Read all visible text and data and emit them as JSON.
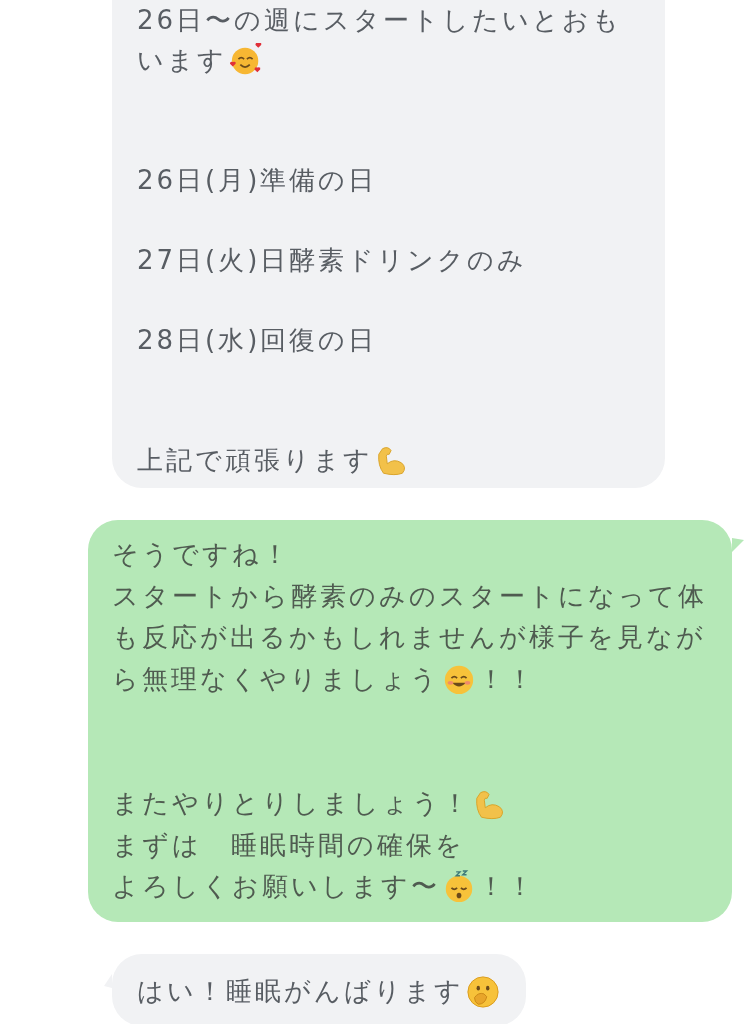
{
  "messages": [
    {
      "kind": "received",
      "lines": [
        {
          "kind": "text",
          "text": "26日〜の週にスタートしたいとおも"
        },
        {
          "kind": "emoji",
          "text": "います"
        },
        {
          "kind": "blank"
        },
        {
          "kind": "blank"
        },
        {
          "kind": "text",
          "text": "26日(月)準備の日"
        },
        {
          "kind": "blank"
        },
        {
          "kind": "text",
          "text": "27日(火)日酵素ドリンクのみ"
        },
        {
          "kind": "blank"
        },
        {
          "kind": "text",
          "text": "28日(水)回復の日"
        },
        {
          "kind": "blank"
        },
        {
          "kind": "blank"
        },
        {
          "kind": "emoji",
          "text": "上記で頑張ります"
        }
      ]
    },
    {
      "kind": "sent",
      "lines": [
        {
          "kind": "text",
          "text": "そうですね！"
        },
        {
          "kind": "text",
          "text": "スタートから酵素のみのスタートになって体"
        },
        {
          "kind": "text",
          "text": "も反応が出るかもしれませんが様子を見なが"
        },
        {
          "kind": "emoji",
          "text": "ら無理なくやりましょう",
          "after": "！！"
        },
        {
          "kind": "blank"
        },
        {
          "kind": "blank"
        },
        {
          "kind": "emoji",
          "text": "またやりとりしましょう！"
        },
        {
          "kind": "text",
          "text": "まずは　睡眠時間の確保を"
        },
        {
          "kind": "emoji",
          "text": "よろしくお願いします〜",
          "after": "！！"
        }
      ]
    },
    {
      "kind": "received",
      "lines": [
        {
          "kind": "emoji",
          "text": "はい！睡眠がんばります"
        }
      ]
    }
  ]
}
